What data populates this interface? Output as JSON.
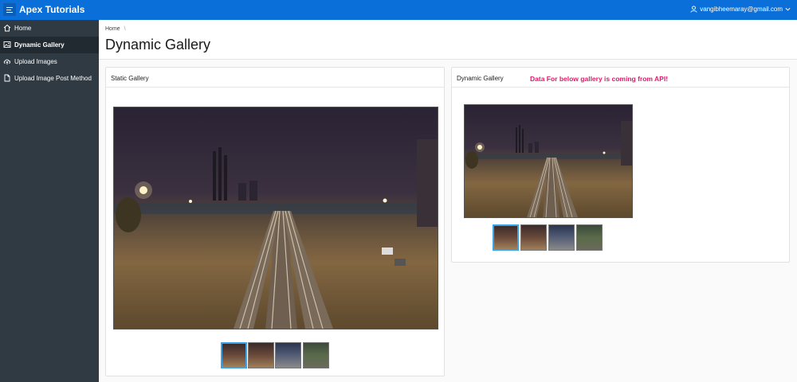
{
  "header": {
    "app_title": "Apex Tutorials",
    "user_email": "vangibheemaray@gmail.com"
  },
  "sidebar": {
    "items": [
      {
        "label": "Home",
        "icon": "home-icon",
        "active": false
      },
      {
        "label": "Dynamic Gallery",
        "icon": "image-icon",
        "active": true
      },
      {
        "label": "Upload Images",
        "icon": "cloud-upload-icon",
        "active": false
      },
      {
        "label": "Upload Image Post Method",
        "icon": "file-icon",
        "active": false
      }
    ]
  },
  "breadcrumb": {
    "home": "Home",
    "separator": "\\"
  },
  "page_title": "Dynamic Gallery",
  "static_gallery": {
    "title": "Static Gallery",
    "thumbnails": [
      "railway-night",
      "railway-dusk",
      "railway-tracks-blue",
      "railway-grass"
    ],
    "selected_index": 0
  },
  "dynamic_gallery": {
    "title": "Dynamic Gallery",
    "note": "Data For below gallery is coming from API!",
    "thumbnails": [
      "railway-night",
      "railway-dusk",
      "railway-tracks-blue",
      "railway-grass"
    ],
    "selected_index": 0
  },
  "colors": {
    "header_bg": "#0a6fd8",
    "sidebar_bg": "#2f3a42",
    "sidebar_active_bg": "#222a31",
    "note_color": "#e01a6b",
    "thumb_selected_border": "#3aa3e8"
  }
}
